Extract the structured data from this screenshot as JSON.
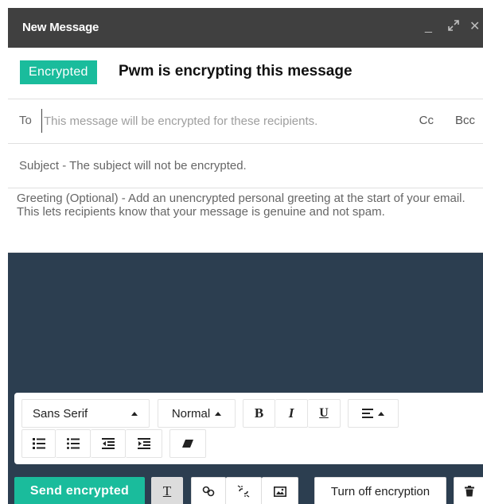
{
  "window": {
    "title": "New Message",
    "controls": {
      "minimize": "_",
      "expand": "⤢",
      "close": "✕"
    }
  },
  "encryption": {
    "badge": "Encrypted",
    "status": "Pwm is encrypting this message",
    "accent_color": "#1abc9c"
  },
  "to": {
    "label": "To",
    "placeholder": "This message will be encrypted for these recipients.",
    "cc": "Cc",
    "bcc": "Bcc"
  },
  "subject": {
    "placeholder": "Subject - The subject will not be encrypted."
  },
  "greeting": {
    "placeholder": "Greeting (Optional) - Add an unencrypted personal greeting at the start of your email. This lets recipients know that your message is genuine and not spam."
  },
  "body": {
    "background": "#2c3e50"
  },
  "formatting": {
    "font_family": "Sans Serif",
    "font_size": "Normal",
    "bold": "B",
    "italic": "I",
    "underline": "U",
    "icons": [
      "align-icon",
      "numbered-list-icon",
      "bulleted-list-icon",
      "indent-less-icon",
      "indent-more-icon",
      "remove-formatting-icon"
    ]
  },
  "actions": {
    "send": "Send encrypted",
    "formatting_toggle": "T",
    "turn_off_encryption": "Turn off encryption",
    "icons": [
      "link-icon",
      "unlink-icon",
      "image-icon",
      "trash-icon"
    ]
  }
}
